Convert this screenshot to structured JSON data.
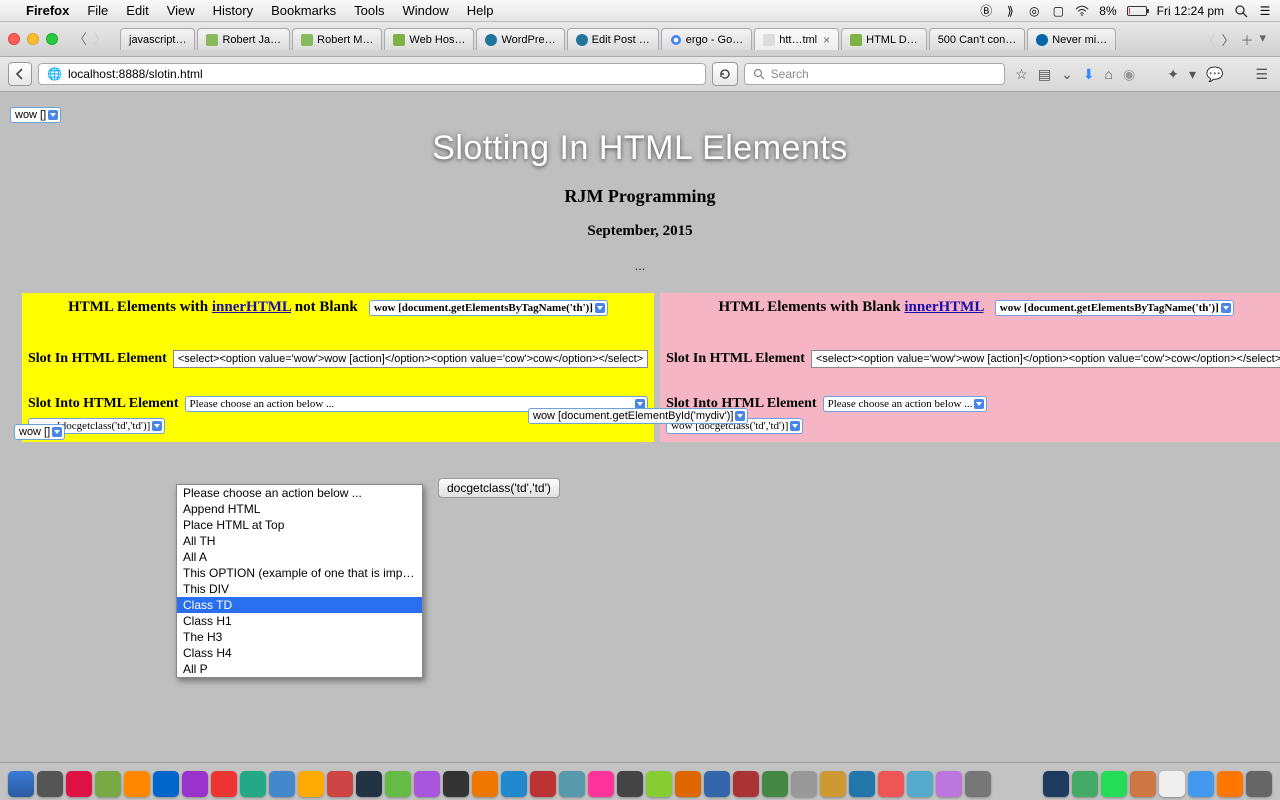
{
  "menubar": {
    "app": "Firefox",
    "items": [
      "File",
      "Edit",
      "View",
      "History",
      "Bookmarks",
      "Tools",
      "Window",
      "Help"
    ],
    "battery_pct": "8%",
    "clock": "Fri 12:24 pm"
  },
  "tabs": [
    {
      "label": "javascript…"
    },
    {
      "label": "Robert Ja…"
    },
    {
      "label": "Robert M…"
    },
    {
      "label": "Web Hos…"
    },
    {
      "label": "WordPre…"
    },
    {
      "label": "Edit Post …"
    },
    {
      "label": "ergo - Go…"
    },
    {
      "label": "htt…tml",
      "active": true
    },
    {
      "label": "HTML D…"
    },
    {
      "label": "500 Can't con…"
    },
    {
      "label": "Never mi…"
    }
  ],
  "url": "localhost:8888/slotin.html",
  "search_placeholder": "Search",
  "top_select": "wow []",
  "page_title": "Slotting In HTML Elements",
  "subtitle1": "RJM Programming",
  "subtitle2": "September, 2015",
  "ellipsis": "...",
  "left": {
    "heading_pre": "HTML Elements with ",
    "heading_link": "innerHTML",
    "heading_post": " not Blank",
    "head_select": "wow [document.getElementsByTagName('th')]",
    "row1_label": "Slot In HTML Element",
    "row1_value": "<select><option value='wow'>wow [action]</option><option value='cow'>cow</option></select>",
    "row2_label": "Slot Into HTML Element",
    "row2_select": "Please choose an action below ...",
    "row3_select": "wow [docgetclass('td','td')]"
  },
  "right": {
    "heading_pre": "HTML Elements with Blank ",
    "heading_link": "innerHTML",
    "head_select": "wow [document.getElementsByTagName('th')]",
    "row1_label": "Slot In HTML Element",
    "row1_value": "<select><option value='wow'>wow [action]</option><option value='cow'>cow</option></select>",
    "row2_label": "Slot Into HTML Element",
    "row2_select": "Please choose an action below ...",
    "row3_select": "wow [docgetclass('td','td')]"
  },
  "dropdown_options": [
    "Please choose an action below ...",
    "Append HTML",
    "Place HTML at Top",
    "All TH",
    "All A",
    "This OPTION (example of one that is impossible)",
    "This DIV",
    "Class TD",
    "Class H1",
    "The H3",
    "Class H4",
    "All P"
  ],
  "dropdown_selected_index": 7,
  "bottom_left_select": "wow []",
  "mid_select": "wow [document.getElementById('mydiv')]",
  "mid_button": "docgetclass('td','td')"
}
